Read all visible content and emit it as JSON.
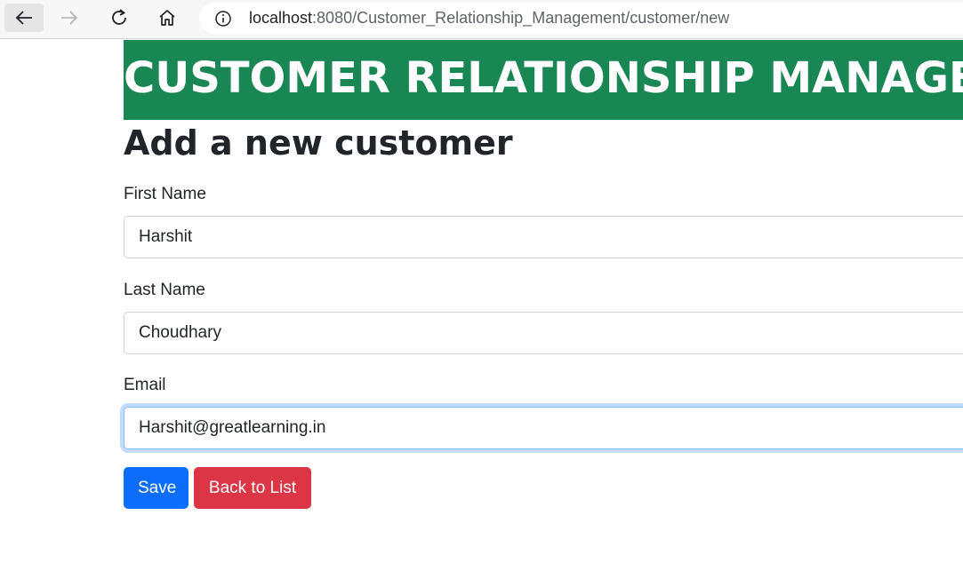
{
  "browser": {
    "url_host": "localhost",
    "url_rest": ":8080/Customer_Relationship_Management/customer/new"
  },
  "page": {
    "banner": "CUSTOMER RELATIONSHIP MANAGEMENT",
    "title": "Add a new customer"
  },
  "form": {
    "first_name": {
      "label": "First Name",
      "value": "Harshit"
    },
    "last_name": {
      "label": "Last Name",
      "value": "Choudhary"
    },
    "email": {
      "label": "Email",
      "value": "Harshit@greatlearning.in"
    }
  },
  "buttons": {
    "save": "Save",
    "back": "Back to List"
  },
  "colors": {
    "banner_bg": "#198754",
    "save_bg": "#0d6efd",
    "back_bg": "#dc3545"
  },
  "icons": [
    "back-arrow-icon",
    "forward-arrow-icon",
    "reload-icon",
    "home-icon",
    "info-icon"
  ]
}
